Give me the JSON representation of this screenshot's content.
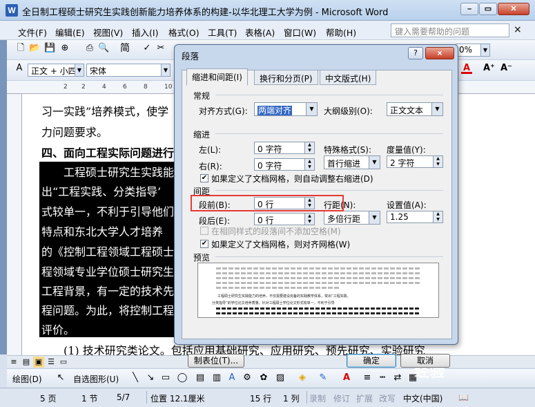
{
  "window": {
    "title": "全日制工程硕士研究生实践创新能力培养体系的构建-以华北理工大学为例 - Microsoft Word",
    "app_icon": "W"
  },
  "menubar": {
    "items": [
      "文件(F)",
      "编辑(E)",
      "视图(V)",
      "插入(I)",
      "格式(O)",
      "工具(T)",
      "表格(A)",
      "窗口(W)",
      "帮助(H)"
    ],
    "help_placeholder": "键入需要帮助的问题",
    "close_glyph": "×"
  },
  "toolbar": {
    "style_value": "正文 + 小四",
    "font_value": "宋体",
    "zoom_value": "0%",
    "simplified": "简",
    "font_color_letter": "A"
  },
  "ruler": {
    "numbers": [
      "2",
      "2",
      "4",
      "6",
      "8",
      "10",
      "12",
      "14",
      "16",
      "18",
      "20",
      "22",
      "24",
      "26",
      "28",
      "30",
      "32"
    ]
  },
  "document": {
    "lines": [
      "习一实践”培养模式，使学",
      "力问题要求。",
      "四、面向工程实际问题进行",
      "工程硕士研究生实践能",
      "出“工程实践、分类指导’",
      "式较单一，不利于引导他们",
      "特点和东北大学人才培养",
      "的《控制工程领域工程硕士",
      "程领域专业学位硕士研究生",
      "工程背景，有一定的技术先",
      "程问题。为此，将控制工程",
      "评价。",
      "(1) 技术研究类论文。包括应用基础研究、应用研究、预先研究、实验研究"
    ]
  },
  "dialog": {
    "title": "段落",
    "help_glyph": "?",
    "close_glyph": "×",
    "tabs": [
      "缩进和间距(I)",
      "换行和分页(P)",
      "中文版式(H)"
    ],
    "general": {
      "section": "常规",
      "align_label": "对齐方式(G):",
      "align_value": "两端对齐",
      "outline_label": "大纲级别(O):",
      "outline_value": "正文文本"
    },
    "indent": {
      "section": "缩进",
      "left_label": "左(L):",
      "left_value": "0 字符",
      "right_label": "右(R):",
      "right_value": "0 字符",
      "special_label": "特殊格式(S):",
      "special_value": "首行缩进",
      "by_label": "度量值(Y):",
      "by_value": "2 字符",
      "grid_check": "如果定义了文档网格，则自动调整右缩进(D)",
      "grid_checked": true
    },
    "spacing": {
      "section": "间距",
      "before_label": "段前(B):",
      "before_value": "0 行",
      "after_label": "段后(E):",
      "after_value": "0 行",
      "line_label": "行距(N):",
      "line_value": "多倍行距",
      "at_label": "设置值(A):",
      "at_value": "1.25",
      "nosame_check": "在相同样式的段落间不添加空格(M)",
      "nosame_checked": false,
      "snap_check": "如果定义了文档网格，则对齐网格(W)",
      "snap_checked": true
    },
    "preview": {
      "section": "预览",
      "sample_1": "工程硕士研究生实践能力的培养，不仅需要建设完备的实践教学体系，突出“工程实践、",
      "sample_2": "分类指导”的学位论文培养质量。针对工程硕士学位论文形式较单一，不利于引导"
    },
    "buttons": {
      "tabs": "制表位(T)...",
      "ok": "确定",
      "cancel": "取消"
    }
  },
  "drawbar": {
    "draw": "绘图(D)",
    "autoshape": "自选图形(U)"
  },
  "statusbar": {
    "page": "5 页",
    "section": "1 节",
    "pages": "5/7",
    "position": "位置 12.1厘米",
    "line": "15 行",
    "col": "1 列",
    "rec": "录制",
    "trk": "修订",
    "ext": "扩展",
    "ovr": "改写",
    "lang": "中文(中国)"
  },
  "watermark": "经验"
}
